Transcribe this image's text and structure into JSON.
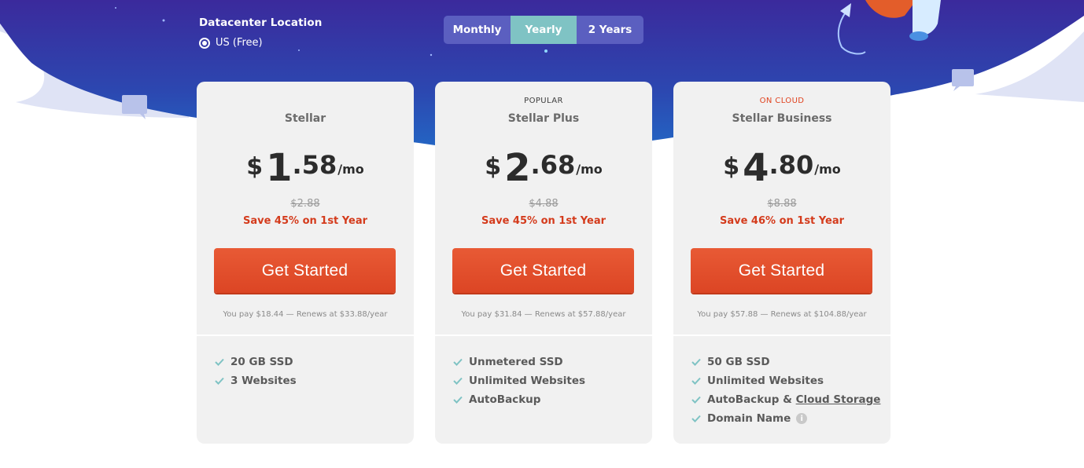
{
  "datacenter": {
    "title": "Datacenter Location",
    "option": "US (Free)"
  },
  "billing_toggle": {
    "options": [
      "Monthly",
      "Yearly",
      "2 Years"
    ],
    "selected": "Yearly"
  },
  "colors": {
    "hero_dark": "#3a2a9e",
    "hero_mid": "#2756b8",
    "toggle_active": "#7fc3c4",
    "cta": "#e34e2c",
    "save_text": "#d43b1c",
    "check": "#7fc3c4"
  },
  "plans": [
    {
      "badge": "",
      "name": "Stellar",
      "currency": "$",
      "price_int": "1",
      "price_dec": ".58",
      "period": "/mo",
      "old_price": "$2.88",
      "save": "Save 45% on 1st Year",
      "cta": "Get Started",
      "renewal": "You pay $18.44 — Renews at $33.88/year",
      "features": [
        "20 GB SSD",
        "3 Websites"
      ]
    },
    {
      "badge": "POPULAR",
      "name": "Stellar Plus",
      "currency": "$",
      "price_int": "2",
      "price_dec": ".68",
      "period": "/mo",
      "old_price": "$4.88",
      "save": "Save 45% on 1st Year",
      "cta": "Get Started",
      "renewal": "You pay $31.84 — Renews at $57.88/year",
      "features": [
        "Unmetered SSD",
        "Unlimited Websites",
        "AutoBackup"
      ]
    },
    {
      "badge": "ON CLOUD",
      "name": "Stellar Business",
      "currency": "$",
      "price_int": "4",
      "price_dec": ".80",
      "period": "/mo",
      "old_price": "$8.88",
      "save": "Save 46% on 1st Year",
      "cta": "Get Started",
      "renewal": "You pay $57.88 — Renews at $104.88/year",
      "features": [
        "50 GB SSD",
        "Unlimited Websites",
        "AutoBackup & ",
        "Domain Name"
      ],
      "feature_link": "Cloud Storage",
      "info_icon": "i"
    }
  ],
  "icons": {
    "check": "check-icon",
    "info": "info-icon",
    "radio": "radio-selected-icon"
  }
}
